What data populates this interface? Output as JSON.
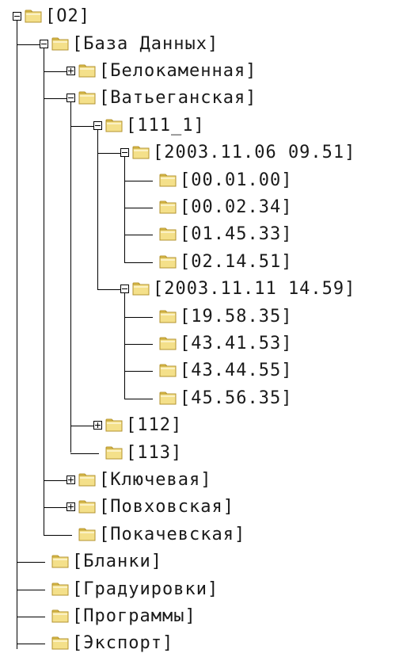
{
  "tree": {
    "label": "[O2]",
    "expanded": true,
    "children": [
      {
        "label": "[База Данных]",
        "expanded": true,
        "children": [
          {
            "label": "[Белокаменная]",
            "expanded": false,
            "hasChildren": true
          },
          {
            "label": "[Ватьеганская]",
            "expanded": true,
            "children": [
              {
                "label": "[111_1]",
                "expanded": true,
                "children": [
                  {
                    "label": "[2003.11.06 09.51]",
                    "expanded": true,
                    "children": [
                      {
                        "label": "[00.01.00]"
                      },
                      {
                        "label": "[00.02.34]"
                      },
                      {
                        "label": "[01.45.33]"
                      },
                      {
                        "label": "[02.14.51]"
                      }
                    ]
                  },
                  {
                    "label": "[2003.11.11 14.59]",
                    "expanded": true,
                    "children": [
                      {
                        "label": "[19.58.35]"
                      },
                      {
                        "label": "[43.41.53]"
                      },
                      {
                        "label": "[43.44.55]"
                      },
                      {
                        "label": "[45.56.35]"
                      }
                    ]
                  }
                ]
              },
              {
                "label": "[112]",
                "expanded": false,
                "hasChildren": true
              },
              {
                "label": "[113]"
              }
            ]
          },
          {
            "label": "[Ключевая]",
            "expanded": false,
            "hasChildren": true
          },
          {
            "label": "[Повховская]",
            "expanded": false,
            "hasChildren": true
          },
          {
            "label": "[Покачевская]"
          }
        ]
      },
      {
        "label": "[Бланки]"
      },
      {
        "label": "[Градуировки]"
      },
      {
        "label": "[Программы]"
      },
      {
        "label": "[Экспорт]"
      }
    ]
  },
  "colors": {
    "line": "#000000",
    "folder_fill": "#f4e08a",
    "folder_tab": "#e8c84a",
    "folder_edge": "#b39330",
    "text": "#1a1a1a"
  },
  "icons": {
    "folder": "folder-icon",
    "expand": "plus-box-icon",
    "collapse": "minus-box-icon"
  }
}
